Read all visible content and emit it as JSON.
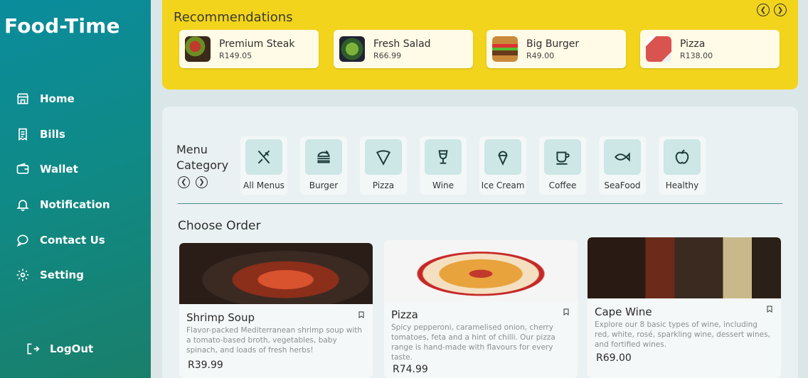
{
  "app": {
    "brand": "Food-Time"
  },
  "sidebar": {
    "items": [
      {
        "label": "Home",
        "icon": "store-icon"
      },
      {
        "label": "Bills",
        "icon": "receipt-icon"
      },
      {
        "label": "Wallet",
        "icon": "wallet-icon"
      },
      {
        "label": "Notification",
        "icon": "bell-icon"
      },
      {
        "label": "Contact Us",
        "icon": "chat-icon"
      },
      {
        "label": "Setting",
        "icon": "gear-icon"
      }
    ],
    "logout": {
      "label": "LogOut",
      "icon": "logout-icon"
    }
  },
  "recommendations": {
    "title": "Recommendations",
    "items": [
      {
        "name": "Premium Steak",
        "price": "R149.05"
      },
      {
        "name": "Fresh Salad",
        "price": "R66.99"
      },
      {
        "name": "Big Burger",
        "price": "R49.00"
      },
      {
        "name": "Pizza",
        "price": "R138.00"
      }
    ]
  },
  "menu": {
    "label_line1": "Menu",
    "label_line2": "Category",
    "categories": [
      {
        "label": "All Menus",
        "icon": "utensils-icon"
      },
      {
        "label": "Burger",
        "icon": "burger-icon"
      },
      {
        "label": "Pizza",
        "icon": "pizza-icon"
      },
      {
        "label": "Wine",
        "icon": "wine-glass-icon"
      },
      {
        "label": "Ice Cream",
        "icon": "ice-cream-icon"
      },
      {
        "label": "Coffee",
        "icon": "coffee-cup-icon"
      },
      {
        "label": "SeaFood",
        "icon": "fish-icon"
      },
      {
        "label": "Healthy",
        "icon": "apple-icon"
      }
    ]
  },
  "orders": {
    "title": "Choose Order",
    "items": [
      {
        "name": "Shrimp Soup",
        "description": "Flavor-packed Mediterranean shrimp soup with a tomato-based broth, vegetables, baby spinach, and loads of fresh herbs!",
        "price": "R39.99"
      },
      {
        "name": "Pizza",
        "description": "Spicy pepperoni, caramelised onion, cherry tomatoes, feta and a hint of chilli. Our pizza range is hand-made with flavours for every taste.",
        "price": "R74.99"
      },
      {
        "name": "Cape Wine",
        "description": "Explore our 8 basic types of wine, including red, white, rosé, sparkling wine, dessert wines, and fortified wines.",
        "price": "R69.00"
      }
    ]
  },
  "colors": {
    "sidebar": "#0f8a87",
    "accent_yellow": "#f2d41c",
    "icon_tile": "#cde6e6"
  }
}
